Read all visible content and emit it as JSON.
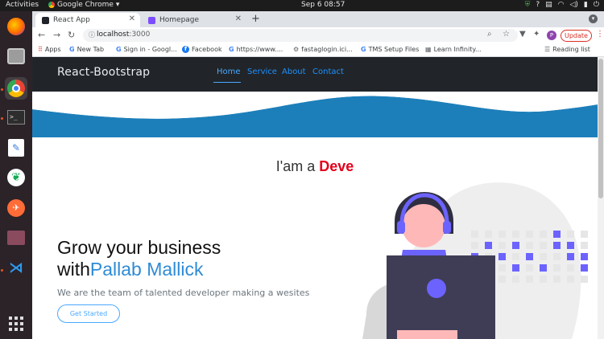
{
  "os": {
    "activities": "Activities",
    "app_name": "Google Chrome",
    "clock": "Sep 6  08:57"
  },
  "browser": {
    "tabs": [
      {
        "title": "React App",
        "active": true,
        "favicon_color": "#20232a"
      },
      {
        "title": "Homepage",
        "active": false,
        "favicon_color": "#7c4dff"
      }
    ],
    "url_host": "localhost",
    "url_port": ":3000",
    "avatar_letter": "P",
    "update_label": "Update",
    "bookmarks": [
      {
        "label": "Apps",
        "icon": "apps-grid-icon"
      },
      {
        "label": "New Tab",
        "icon": "google-icon"
      },
      {
        "label": "Sign in - Googl...",
        "icon": "google-icon"
      },
      {
        "label": "Facebook",
        "icon": "facebook-icon"
      },
      {
        "label": "https://www....",
        "icon": "google-icon"
      },
      {
        "label": "fastaglogin.ici...",
        "icon": "page-icon"
      },
      {
        "label": "TMS Setup Files",
        "icon": "google-icon"
      },
      {
        "label": "Learn Infinity...",
        "icon": "page-icon"
      }
    ],
    "reading_list": "Reading list"
  },
  "site": {
    "brand": "React-Bootstrap",
    "nav": [
      "Home",
      "Service",
      "About",
      "Contact"
    ],
    "active_nav": "Home",
    "typed_prefix": "I'am a ",
    "typed_word": "Deve",
    "headline_line1": "Grow your business",
    "headline_with": "with",
    "headline_name": "Pallab Mallick",
    "tagline": "We are the team of talented developer making a wesites",
    "cta": "Get Started"
  },
  "colors": {
    "navbar_bg": "#212529",
    "wave_blue": "#1d7fba",
    "accent_red": "#e3001b",
    "accent_blue": "#2e8bd6",
    "illustration_purple": "#6c63ff"
  }
}
